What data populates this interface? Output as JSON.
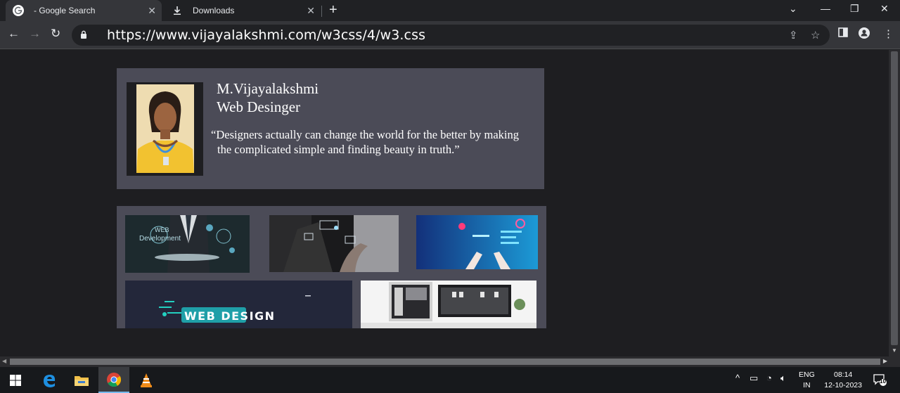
{
  "tabs": [
    {
      "title": "- Google Search",
      "icon": "google-icon"
    },
    {
      "title": "Downloads",
      "icon": "download-icon"
    }
  ],
  "toolbar": {
    "url": "https://www.vijayalakshmi.com/w3css/4/w3.css"
  },
  "profile": {
    "name": "M.Vijayalakshmi",
    "role": "Web Desinger",
    "quote_line1": "“Designers actually can change the world for the better by making",
    "quote_line2": "the complicated simple and finding beauty in truth.”"
  },
  "gallery": {
    "img1_text_a": "WEB",
    "img1_text_b": "Development",
    "img4_text": "WEB DESIGN"
  },
  "taskbar": {
    "lang_top": "ENG",
    "lang_bottom": "IN",
    "time": "08:14",
    "date": "12-10-2023",
    "notifications": "10"
  },
  "colors": {
    "browser_bg": "#202124",
    "toolbar_bg": "#35363a",
    "card_bg": "#4b4b57",
    "page_bg": "#1e1e21"
  }
}
